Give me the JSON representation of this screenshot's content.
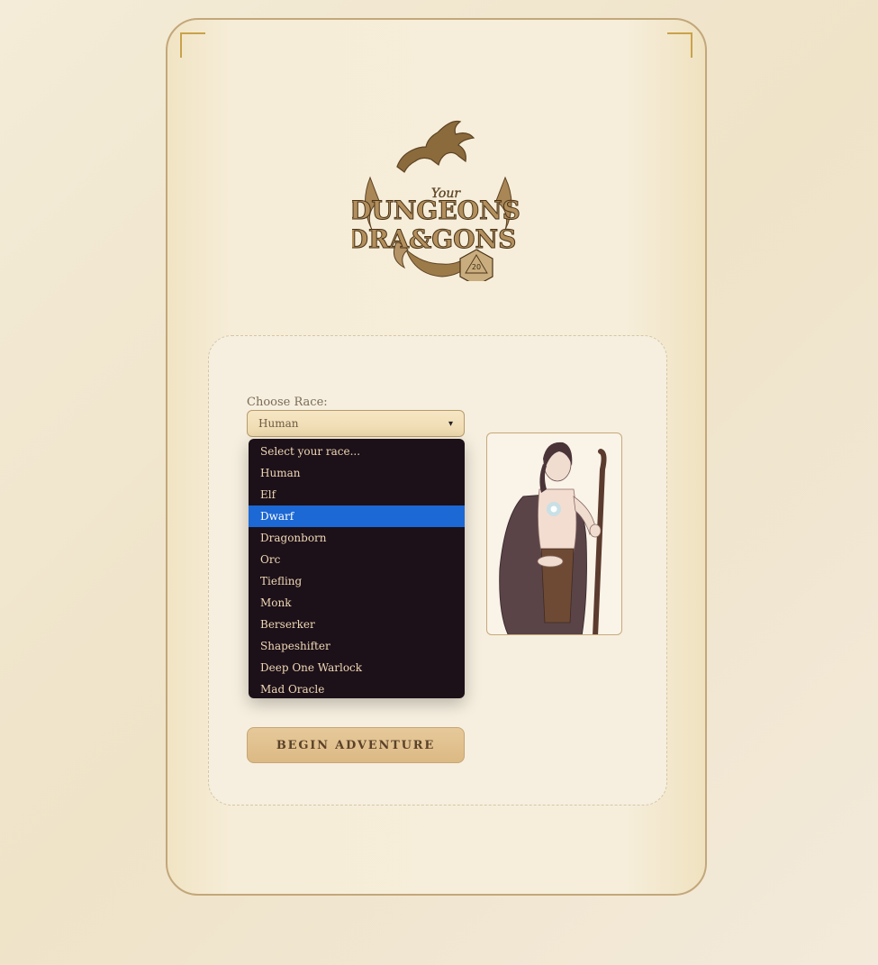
{
  "logo": {
    "line1": "Your",
    "line2": "DUNGEONS",
    "line3": "DRA&GONS",
    "die_face": "20"
  },
  "form": {
    "race_label": "Choose Race:",
    "race_selected": "Human",
    "race_options": [
      "Select your race...",
      "Human",
      "Elf",
      "Dwarf",
      "Dragonborn",
      "Orc",
      "Tiefling",
      "Monk",
      "Berserker",
      "Shapeshifter",
      "Deep One Warlock",
      "Mad Oracle"
    ],
    "highlighted_option": "Dwarf",
    "begin_label": "BEGIN ADVENTURE"
  },
  "colors": {
    "accent_gold": "#c9a24a",
    "dropdown_bg": "#1c1019",
    "highlight": "#1c68d4"
  }
}
